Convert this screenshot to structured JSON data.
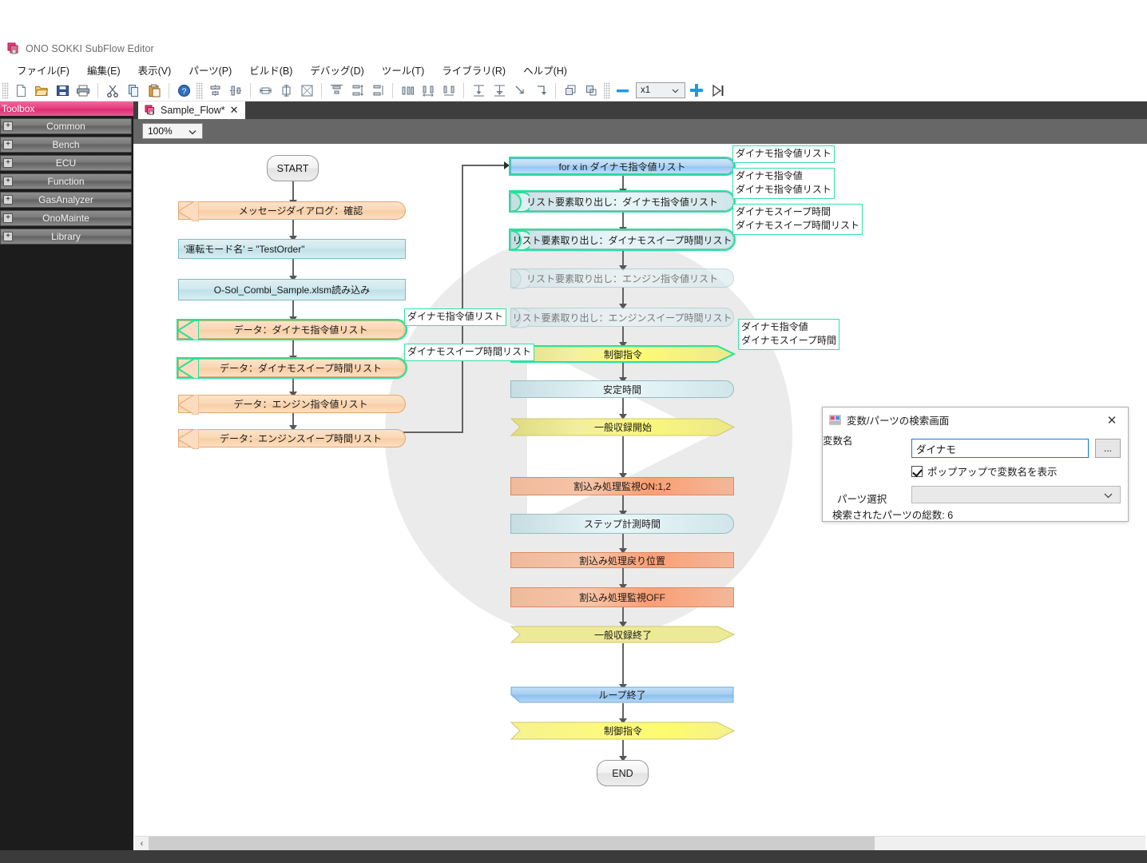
{
  "window": {
    "title": "ONO SOKKI SubFlow Editor",
    "app_icon": "app-logo-icon"
  },
  "menu": {
    "items": [
      {
        "label": "ファイル(F)"
      },
      {
        "label": "編集(E)"
      },
      {
        "label": "表示(V)"
      },
      {
        "label": "パーツ(P)"
      },
      {
        "label": "ビルド(B)"
      },
      {
        "label": "デバッグ(D)"
      },
      {
        "label": "ツール(T)"
      },
      {
        "label": "ライブラリ(R)"
      },
      {
        "label": "ヘルプ(H)"
      }
    ]
  },
  "toolbar": {
    "step_value": "x1",
    "icons": [
      "new-file-icon",
      "open-folder-icon",
      "save-icon",
      "print-icon",
      "cut-icon",
      "copy-icon",
      "paste-icon",
      "help-icon",
      "align-center-vertical-icon",
      "align-middle-icon",
      "same-width-icon",
      "same-height-icon",
      "same-size-icon",
      "align-top-icon",
      "distribute-vertical-icon",
      "space-vertical-icon",
      "align-horizontal-icon",
      "distribute-horizontal-icon",
      "space-horizontal-icon",
      "align-bottom-icon",
      "align-baseline-icon",
      "step-into-icon",
      "step-over-icon",
      "bring-front-icon",
      "send-back-icon",
      "minus-icon",
      "plus-icon",
      "run-to-end-icon"
    ]
  },
  "sidebar": {
    "header": "Toolbox",
    "items": [
      {
        "label": "Common",
        "expander": "+"
      },
      {
        "label": "Bench",
        "expander": "+"
      },
      {
        "label": "ECU",
        "expander": "+"
      },
      {
        "label": "Function",
        "expander": "+"
      },
      {
        "label": "GasAnalyzer",
        "expander": "+"
      },
      {
        "label": "OnoMainte",
        "expander": "+"
      },
      {
        "label": "Library",
        "expander": "+"
      }
    ]
  },
  "tabs": {
    "active": {
      "label": "Sample_Flow*",
      "close": "✕",
      "icon": "flow-document-icon"
    }
  },
  "canvas": {
    "zoom": "100%",
    "nodes": {
      "start": "START",
      "end": "END",
      "msg_dialog": "メッセージダイアログ：確認",
      "mode_assign": "'運転モード名' = \"TestOrder\"",
      "load_xlsm": "O-Sol_Combi_Sample.xlsm読み込み",
      "data_dyno_cmd_list": "データ：ダイナモ指令値リスト",
      "data_dyno_sweep_list": "データ：ダイナモスイープ時間リスト",
      "data_eng_cmd_list": "データ：エンジン指令値リスト",
      "data_eng_sweep_list": "データ：エンジンスイープ時間リスト",
      "for_loop": "for x in ダイナモ指令値リスト",
      "extract_dyno_cmd": "リスト要素取り出し：ダイナモ指令値リスト",
      "extract_dyno_sweep": "リスト要素取り出し：ダイナモスイープ時間リスト",
      "extract_eng_cmd": "リスト要素取り出し：エンジン指令値リスト",
      "extract_eng_sweep": "リスト要素取り出し：エンジンスイープ時間リスト",
      "control_cmd_1": "制御指令",
      "stable_time": "安定時間",
      "rec_start": "一般収録開始",
      "interrupt_on": "割込み処理監視ON:1,2",
      "step_meas_time": "ステップ計測時間",
      "interrupt_return": "割込み処理戻り位置",
      "interrupt_off": "割込み処理監視OFF",
      "rec_end": "一般収録終了",
      "loop_end": "ループ終了",
      "control_cmd_2": "制御指令"
    },
    "var_labels": {
      "right_1": "ダイナモ指令値リスト",
      "right_2_line1": "ダイナモ指令値",
      "right_2_line2": "ダイナモ指令値リスト",
      "right_3_line1": "ダイナモスイープ時間",
      "right_3_line2": "ダイナモスイープ時間リスト",
      "right_4_line1": "ダイナモ指令値",
      "right_4_line2": "ダイナモスイープ時間",
      "left_1": "ダイナモ指令値リスト",
      "left_2": "ダイナモスイープ時間リスト"
    },
    "highlight_color": "#23e39a"
  },
  "search_dialog": {
    "title": "変数/パーツの検索画面",
    "icon": "window-app-icon",
    "close": "✕",
    "var_name_label": "変数名",
    "var_name_value": "ダイナモ",
    "browse_label": "...",
    "checkbox_label": "ポップアップで変数名を表示",
    "checkbox_checked": true,
    "parts_select_label": "パーツ選択",
    "parts_select_value": "",
    "total_label": "検索されたパーツの総数: 6"
  },
  "scrollbar": {
    "left_arrow": "‹"
  }
}
